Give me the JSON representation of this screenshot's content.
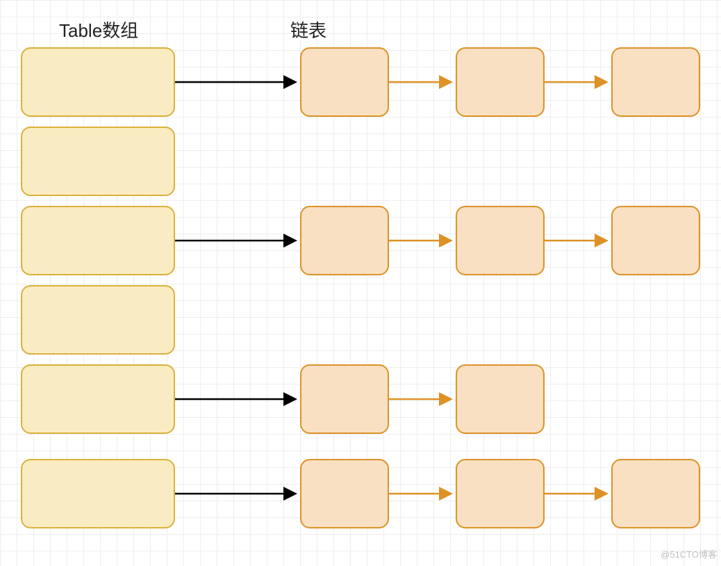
{
  "labels": {
    "tableArray": "Table数组",
    "linkedList": "链表"
  },
  "watermark": "@51CTO博客",
  "diagram": {
    "tableSlots": [
      {
        "index": 0,
        "hasChain": true,
        "chainLength": 3
      },
      {
        "index": 1,
        "hasChain": false,
        "chainLength": 0
      },
      {
        "index": 2,
        "hasChain": true,
        "chainLength": 3
      },
      {
        "index": 3,
        "hasChain": false,
        "chainLength": 0
      },
      {
        "index": 4,
        "hasChain": true,
        "chainLength": 2
      },
      {
        "index": 5,
        "hasChain": true,
        "chainLength": 3
      }
    ],
    "arrowColors": {
      "fromTable": "#000000",
      "betweenNodes": "#dd9227"
    },
    "boxColors": {
      "tableFill": "#faecc2",
      "tableStroke": "#d9b13b",
      "nodeFill": "#f9e0c3",
      "nodeStroke": "#dd9227"
    }
  }
}
